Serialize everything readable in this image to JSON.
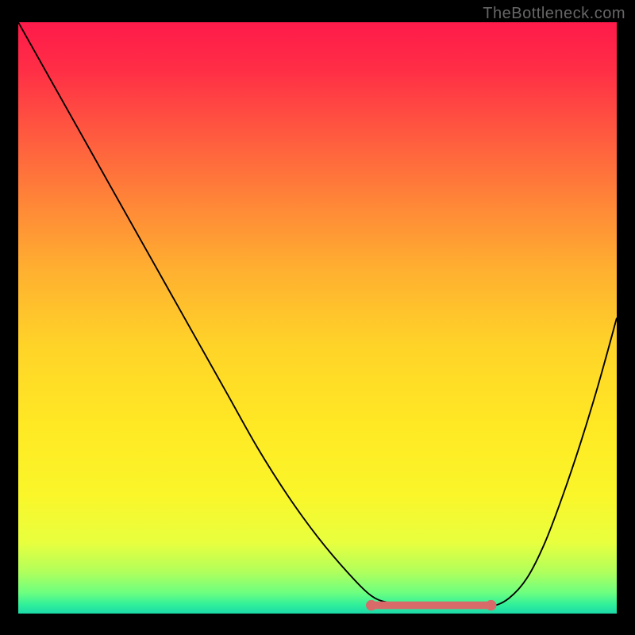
{
  "watermark": "TheBottleneck.com",
  "chart_data": {
    "type": "line",
    "title": "",
    "xlabel": "",
    "ylabel": "",
    "xlim": [
      0,
      100
    ],
    "ylim": [
      0,
      100
    ],
    "background_gradient": {
      "stops": [
        {
          "offset": 0.0,
          "color": "#ff1a4a"
        },
        {
          "offset": 0.08,
          "color": "#ff2e46"
        },
        {
          "offset": 0.18,
          "color": "#ff5640"
        },
        {
          "offset": 0.3,
          "color": "#ff8438"
        },
        {
          "offset": 0.42,
          "color": "#ffb030"
        },
        {
          "offset": 0.55,
          "color": "#ffd428"
        },
        {
          "offset": 0.68,
          "color": "#ffe824"
        },
        {
          "offset": 0.8,
          "color": "#faf62a"
        },
        {
          "offset": 0.88,
          "color": "#e8ff3e"
        },
        {
          "offset": 0.93,
          "color": "#b0ff5c"
        },
        {
          "offset": 0.965,
          "color": "#6cff80"
        },
        {
          "offset": 0.985,
          "color": "#30f09a"
        },
        {
          "offset": 1.0,
          "color": "#1cd9a8"
        }
      ]
    },
    "series": [
      {
        "name": "bottleneck-curve",
        "type": "line",
        "color": "#000000",
        "x": [
          0,
          5,
          10,
          15,
          20,
          25,
          30,
          35,
          40,
          45,
          50,
          55,
          59,
          62,
          65,
          70,
          75,
          79,
          82,
          85,
          88,
          91,
          94,
          97,
          100
        ],
        "y": [
          100,
          91,
          82,
          73,
          64,
          55,
          46,
          37,
          28,
          20,
          13,
          7,
          3,
          1.8,
          1.2,
          1.0,
          1.0,
          1.2,
          2.6,
          6,
          12,
          20,
          29,
          39,
          50
        ]
      },
      {
        "name": "optimal-range",
        "type": "segment",
        "color": "#d86a6a",
        "x": [
          59,
          79
        ],
        "y": [
          1.4,
          1.4
        ],
        "endpoints": true
      }
    ]
  }
}
